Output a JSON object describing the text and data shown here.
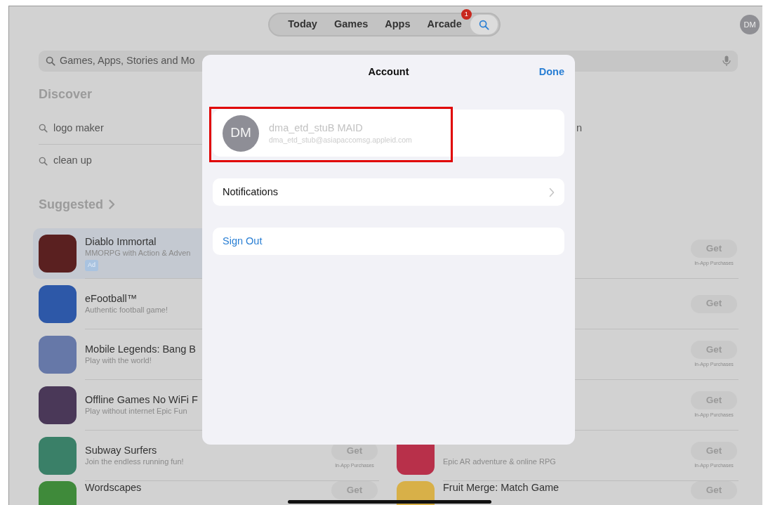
{
  "top_bar": {
    "tabs": [
      {
        "kind": "text",
        "label": "Today",
        "selected": false
      },
      {
        "kind": "text",
        "label": "Games",
        "selected": false
      },
      {
        "kind": "text",
        "label": "Apps",
        "selected": false
      },
      {
        "kind": "text",
        "label": "Arcade",
        "badge": "1",
        "selected": false
      },
      {
        "kind": "search",
        "selected": true
      }
    ],
    "avatar": "DM"
  },
  "search": {
    "placeholder": "Games, Apps, Stories and Mo"
  },
  "discover": {
    "title": "Discover",
    "left": [
      {
        "text": "logo maker"
      },
      {
        "text": "clean up"
      }
    ],
    "right": [
      {
        "text": "n"
      }
    ]
  },
  "suggested": {
    "title": "Suggested",
    "left": [
      {
        "name": "Diablo Immortal",
        "subtitle": "MMORPG with Action & Adven",
        "ad": "Ad",
        "color": "#5a2020",
        "selected": true
      },
      {
        "name": "eFootball™",
        "subtitle": "Authentic football game!",
        "color": "#2d58a8",
        "selected": false
      },
      {
        "name": "Mobile Legends: Bang B",
        "subtitle": "Play with the world!",
        "color": "#6678a8",
        "selected": false
      },
      {
        "name": "Offline Games No WiFi F",
        "subtitle": "Play without internet Epic Fun",
        "color": "#4a3858",
        "selected": false
      },
      {
        "name": "Subway Surfers",
        "subtitle": "Join the endless running fun!",
        "color": "#3a8068",
        "get": "Get",
        "iap": "In-App Purchases",
        "selected": false
      },
      {
        "name": "Wordscapes",
        "color": "#3f8a3a",
        "get": "Get",
        "selected": false
      }
    ],
    "right": [
      {
        "get": "Get",
        "iap": "In-App Purchases",
        "selected": false
      },
      {
        "get": "Get",
        "selected": false
      },
      {
        "get": "Get",
        "iap": "In-App Purchases",
        "selected": false
      },
      {
        "get": "Get",
        "iap": "In-App Purchases",
        "selected": false
      },
      {
        "subtitle": "Epic AR adventure & online RPG",
        "color": "#b8304a",
        "get": "Get",
        "iap": "In-App Purchases",
        "selected": false
      },
      {
        "name": "Fruit Merge: Match Game",
        "color": "#d8b048",
        "get": "Get",
        "selected": false
      }
    ]
  },
  "modal": {
    "title": "Account",
    "done": "Done",
    "account": {
      "avatar": "DM",
      "name": "dma_etd_stuB MAID",
      "email": "dma_etd_stub@asiapaccomsg.appleid.com"
    },
    "rows": [
      {
        "kind": "link",
        "label": "Notifications"
      },
      {
        "kind": "action",
        "label": "Sign Out"
      }
    ]
  }
}
